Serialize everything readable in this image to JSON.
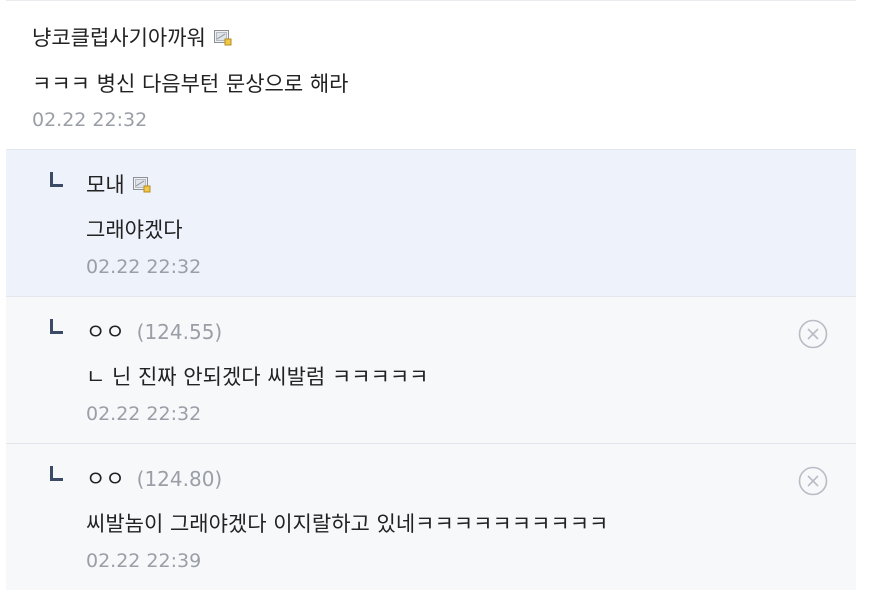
{
  "comments": [
    {
      "nickname": "냥코클럽사기아까워",
      "text": "ㅋㅋㅋ 병신 다음부턴 문상으로 해라",
      "time": "02.22 22:32"
    }
  ],
  "replies": [
    {
      "nickname": "모내",
      "ip": "",
      "text": "그래야겠다",
      "time": "02.22 22:32"
    },
    {
      "nickname": "ㅇㅇ",
      "ip": "(124.55)",
      "text": "ㄴ 닌 진짜 안되겠다 씨발럼 ㅋㅋㅋㅋㅋ",
      "time": "02.22 22:32"
    },
    {
      "nickname": "ㅇㅇ",
      "ip": "(124.80)",
      "text": "씨발놈이 그래야겠다 이지랄하고 있네ㅋㅋㅋㅋㅋㅋㅋㅋㅋㅋ",
      "time": "02.22 22:39"
    }
  ],
  "icons": {
    "memo": "memo-icon",
    "reply": "reply-arrow-icon",
    "delete": "delete-circle-x-icon"
  },
  "colors": {
    "reply_highlight_bg": "#eef2fb",
    "reply_bg": "#f7f8fa",
    "meta_gray": "#9a9ea6",
    "arrow": "#3b4b66"
  }
}
